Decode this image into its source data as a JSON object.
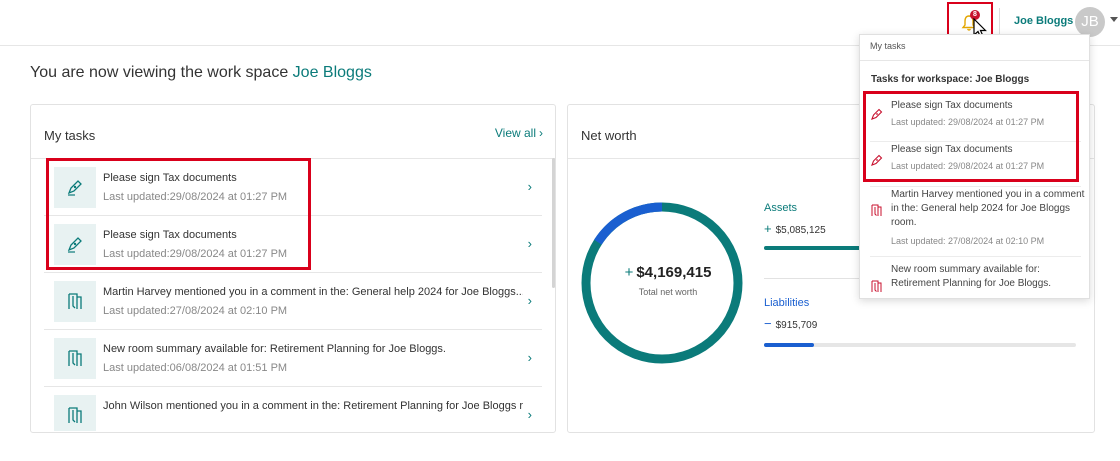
{
  "header": {
    "user_name": "Joe Bloggs",
    "avatar_initials": "JB",
    "notification_count": "8"
  },
  "workspace": {
    "prefix": "You are now viewing the work space ",
    "name": "Joe Bloggs"
  },
  "my_tasks": {
    "title": "My tasks",
    "view_all": "View all",
    "items": [
      {
        "icon": "sign-pen-icon",
        "title": "Please sign Tax documents",
        "date": "Last updated:29/08/2024 at 01:27 PM"
      },
      {
        "icon": "sign-pen-icon",
        "title": "Please sign Tax documents",
        "date": "Last updated:29/08/2024 at 01:27 PM"
      },
      {
        "icon": "room-door-icon",
        "title": "Martin Harvey mentioned you in a comment in the: General help 2024 for Joe Bloggs...",
        "date": "Last updated:27/08/2024 at 02:10 PM"
      },
      {
        "icon": "room-door-icon",
        "title": "New room summary available for: Retirement Planning for Joe Bloggs.",
        "date": "Last updated:06/08/2024 at 01:51 PM"
      },
      {
        "icon": "room-door-icon",
        "title": "John Wilson mentioned you in a comment in the: Retirement Planning for Joe Bloggs r...",
        "date": ""
      }
    ]
  },
  "net_worth": {
    "title": "Net worth",
    "total": "$4,169,415",
    "total_label": "Total net worth",
    "assets_label": "Assets",
    "assets_value": "$5,085,125",
    "liabilities_label": "Liabilities",
    "liabilities_value": "$915,709",
    "assets_share": 0.85,
    "liabilities_share": 0.16,
    "colors": {
      "assets": "#0b7b7a",
      "liabilities": "#1a5fd0"
    }
  },
  "notifications": {
    "header": "My tasks",
    "subheader": "Tasks for workspace: Joe Bloggs",
    "items": [
      {
        "icon": "sign-pen-icon",
        "title": "Please sign Tax documents",
        "date": "Last updated: 29/08/2024 at 01:27 PM"
      },
      {
        "icon": "sign-pen-icon",
        "title": "Please sign Tax documents",
        "date": "Last updated: 29/08/2024 at 01:27 PM"
      },
      {
        "icon": "room-door-icon",
        "title": "Martin Harvey mentioned you in a comment in the: General help 2024 for Joe Bloggs room.",
        "date": "Last updated: 27/08/2024 at 02:10 PM"
      },
      {
        "icon": "room-door-icon",
        "title": "New room summary available for: Retirement Planning for Joe Bloggs.",
        "date": ""
      }
    ]
  }
}
